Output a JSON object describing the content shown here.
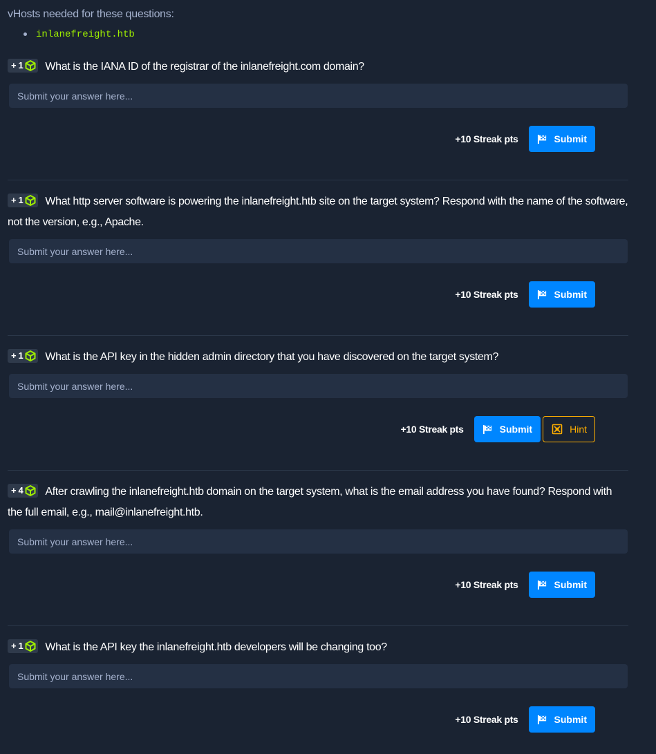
{
  "vhosts": {
    "title": "vHosts needed for these questions:",
    "items": [
      "inlanefreight.htb"
    ]
  },
  "placeholder": "Submit your answer here...",
  "streak_label": "+10 Streak pts",
  "submit_label": "Submit",
  "hint_label": "Hint",
  "colors": {
    "background": "#1a2332",
    "input": "#243044",
    "submit": "#0086ff",
    "hint": "#ffaf00",
    "accent_green": "#9fef00"
  },
  "questions": [
    {
      "badge": "+ 1",
      "text": "What is the IANA ID of the registrar of the inlanefreight.com domain?",
      "has_hint": false
    },
    {
      "badge": "+ 1",
      "text": "What http server software is powering the inlanefreight.htb site on the target system? Respond with the name of the software, not the version, e.g., Apache.",
      "has_hint": false
    },
    {
      "badge": "+ 1",
      "text": "What is the API key in the hidden admin directory that you have discovered on the target system?",
      "has_hint": true
    },
    {
      "badge": "+ 4",
      "text": "After crawling the inlanefreight.htb domain on the target system, what is the email address you have found? Respond with the full email, e.g., mail@inlanefreight.htb.",
      "has_hint": false
    },
    {
      "badge": "+ 1",
      "text": "What is the API key the inlanefreight.htb developers will be changing too?",
      "has_hint": false
    }
  ]
}
